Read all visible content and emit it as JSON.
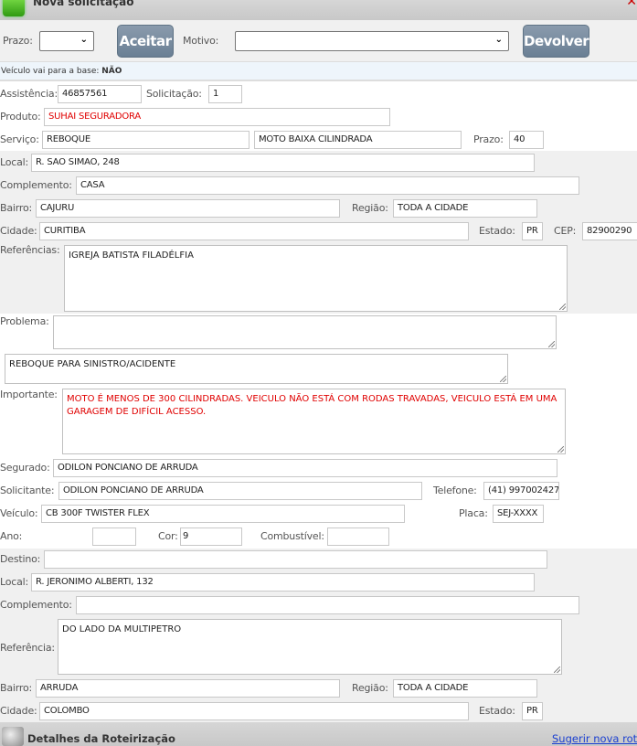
{
  "window": {
    "title": "Nova solicitação",
    "close_icon": "close-icon"
  },
  "toolbar": {
    "prazo_label": "Prazo:",
    "prazo_value": "",
    "accept_label": "Aceitar",
    "motivo_label": "Motivo:",
    "motivo_value": "",
    "return_label": "Devolver"
  },
  "info": {
    "text": "Veículo vai para a base:",
    "value": "NÃO"
  },
  "form": {
    "assistencia": {
      "label": "Assistência:",
      "value": "46857561"
    },
    "solicitacao": {
      "label": "Solicitação:",
      "value": "1"
    },
    "produto": {
      "label": "Produto:",
      "value": "SUHAI SEGURADORA"
    },
    "servico": {
      "label": "Serviço:",
      "value": "REBOQUE",
      "value2": "MOTO BAIXA CILINDRADA"
    },
    "prazo": {
      "label": "Prazo:",
      "value": "40"
    },
    "local": {
      "label": "Local:",
      "value": "R. SAO SIMAO, 248"
    },
    "complemento": {
      "label": "Complemento:",
      "value": "CASA"
    },
    "bairro": {
      "label": "Bairro:",
      "value": "CAJURU"
    },
    "regiao": {
      "label": "Região:",
      "value": "TODA A CIDADE"
    },
    "cidade": {
      "label": "Cidade:",
      "value": "CURITIBA"
    },
    "estado": {
      "label": "Estado:",
      "value": "PR"
    },
    "cep": {
      "label": "CEP:",
      "value": "82900290"
    },
    "referencias": {
      "label": "Referências:",
      "value": "IGREJA BATISTA FILADÉLFIA"
    },
    "problema": {
      "label": "Problema:",
      "value": "",
      "value2": "REBOQUE PARA SINISTRO/ACIDENTE"
    },
    "importante": {
      "label": "Importante:",
      "value": "MOTO É MENOS DE 300 CILINDRADAS. VEICULO NÃO ESTÁ COM RODAS TRAVADAS, VEICULO ESTÁ EM UMA GARAGEM DE DIFÍCIL ACESSO."
    },
    "segurado": {
      "label": "Segurado:",
      "value": "ODILON PONCIANO DE ARRUDA"
    },
    "solicitante": {
      "label": "Solicitante:",
      "value": "ODILON PONCIANO DE ARRUDA"
    },
    "telefone": {
      "label": "Telefone:",
      "value": "(41) 997002427"
    },
    "veiculo": {
      "label": "Veículo:",
      "value": "CB 300F TWISTER FLEX"
    },
    "placa": {
      "label": "Placa:",
      "value": "SEJ-XXXX"
    },
    "ano": {
      "label": "Ano:",
      "value": ""
    },
    "cor": {
      "label": "Cor:",
      "value": "9"
    },
    "combustivel": {
      "label": "Combustível:",
      "value": ""
    }
  },
  "destino": {
    "destino": {
      "label": "Destino:",
      "value": ""
    },
    "local": {
      "label": "Local:",
      "value": "R. JERONIMO ALBERTI, 132"
    },
    "complemento": {
      "label": "Complemento:",
      "value": ""
    },
    "referencia": {
      "label": "Referência:",
      "value": "DO LADO DA MULTIPETRO"
    },
    "bairro": {
      "label": "Bairro:",
      "value": "ARRUDA"
    },
    "regiao": {
      "label": "Região:",
      "value": "TODA A CIDADE"
    },
    "cidade": {
      "label": "Cidade:",
      "value": "COLOMBO"
    },
    "estado": {
      "label": "Estado:",
      "value": "PR"
    }
  },
  "footer": {
    "title": "Detalhes da Roteirização",
    "link": "Sugerir nova rota"
  }
}
